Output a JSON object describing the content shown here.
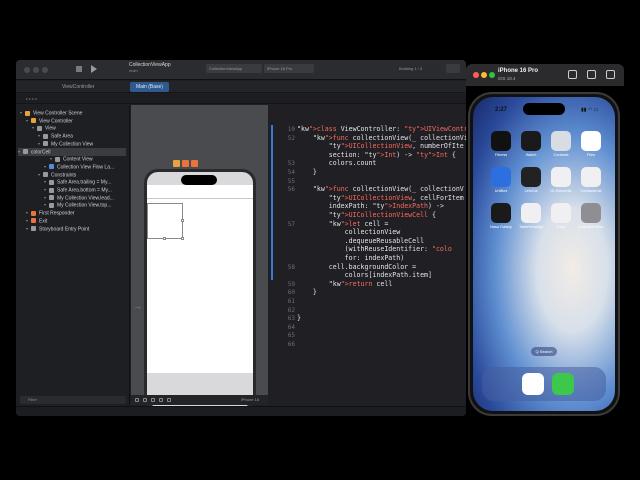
{
  "xcode": {
    "project_title": "CollectionViewApp",
    "project_subtitle": "main",
    "scheme": "CollectionViewApp",
    "device_target": "iPhone 16 Pro",
    "build_status": "Building 1 / 3",
    "tabs": [
      "ViewController",
      "Main (Base)"
    ],
    "filter_placeholder": "Filter",
    "canvas_device_label": "iPhone 16",
    "outline": [
      {
        "label": "View Controller Scene",
        "level": 0,
        "icon_color": "#e8a33d"
      },
      {
        "label": "View Controller",
        "level": 1,
        "icon_color": "#e8a33d"
      },
      {
        "label": "View",
        "level": 2,
        "icon_color": "#9a9a9e"
      },
      {
        "label": "Safe Area",
        "level": 3,
        "icon_color": "#9a9a9e"
      },
      {
        "label": "My Collection View",
        "level": 3,
        "icon_color": "#9a9a9e"
      },
      {
        "label": "colorCell",
        "level": 4,
        "icon_color": "#9a9a9e",
        "selected": true
      },
      {
        "label": "Content View",
        "level": 5,
        "icon_color": "#9a9a9e"
      },
      {
        "label": "Collection View Flow La...",
        "level": 4,
        "icon_color": "#5a8ad8"
      },
      {
        "label": "Constraints",
        "level": 3,
        "icon_color": "#9a9a9e"
      },
      {
        "label": "Safe Area.trailing = My...",
        "level": 4,
        "icon_color": "#9a9a9e"
      },
      {
        "label": "Safe Area.bottom = My...",
        "level": 4,
        "icon_color": "#9a9a9e"
      },
      {
        "label": "My Collection View.lead...",
        "level": 4,
        "icon_color": "#9a9a9e"
      },
      {
        "label": "My Collection View.top...",
        "level": 4,
        "icon_color": "#9a9a9e"
      },
      {
        "label": "First Responder",
        "level": 1,
        "icon_color": "#e8743d"
      },
      {
        "label": "Exit",
        "level": 1,
        "icon_color": "#e8743d"
      },
      {
        "label": "Storyboard Entry Point",
        "level": 1,
        "icon_color": "#9a9a9e"
      }
    ],
    "code_lines": [
      {
        "n": "10",
        "text": "class ViewController: UIViewController"
      },
      {
        "n": "52",
        "text": "    func collectionView(_ collectionVi"
      },
      {
        "n": "",
        "text": "        UICollectionView, numberOfIte"
      },
      {
        "n": "",
        "text": "        section: Int) -> Int {"
      },
      {
        "n": "53",
        "text": "        colors.count"
      },
      {
        "n": "54",
        "text": "    }"
      },
      {
        "n": "55",
        "text": ""
      },
      {
        "n": "56",
        "text": "    func collectionView(_ collectionV"
      },
      {
        "n": "",
        "text": "        UICollectionView, cellForItem"
      },
      {
        "n": "",
        "text": "        indexPath: IndexPath) ->"
      },
      {
        "n": "",
        "text": "        UICollectionViewCell {"
      },
      {
        "n": "57",
        "text": "        let cell ="
      },
      {
        "n": "",
        "text": "            collectionView"
      },
      {
        "n": "",
        "text": "            .dequeueReusableCell"
      },
      {
        "n": "",
        "text": "            (withReuseIdentifier: \"colo"
      },
      {
        "n": "",
        "text": "            for: indexPath)"
      },
      {
        "n": "58",
        "text": "        cell.backgroundColor ="
      },
      {
        "n": "",
        "text": "            colors[indexPath.item]"
      },
      {
        "n": "59",
        "text": "        return cell"
      },
      {
        "n": "60",
        "text": "    }"
      },
      {
        "n": "61",
        "text": ""
      },
      {
        "n": "62",
        "text": ""
      },
      {
        "n": "63",
        "text": "}"
      },
      {
        "n": "64",
        "text": ""
      },
      {
        "n": "65",
        "text": ""
      },
      {
        "n": "66",
        "text": ""
      }
    ]
  },
  "simulator": {
    "device_name": "iPhone 16 Pro",
    "os_version": "iOS 18.4",
    "status_time": "2:27",
    "apps": [
      {
        "label": "Fitness",
        "color": "#111111",
        "icon": "fitness-icon"
      },
      {
        "label": "Watch",
        "color": "#1a1a1a",
        "icon": "watch-icon"
      },
      {
        "label": "Contacts",
        "color": "#d9dde3",
        "icon": "contacts-icon"
      },
      {
        "label": "Files",
        "color": "#ffffff",
        "icon": "files-icon"
      },
      {
        "label": "Uniflies",
        "color": "#2d6fe0",
        "icon": "uniflies-icon"
      },
      {
        "label": "LetsCal",
        "color": "#222222",
        "icon": "letscal-icon"
      },
      {
        "label": "UI-Elements",
        "color": "#f0f0f2",
        "icon": "ui-elements-icon"
      },
      {
        "label": "ContactsList",
        "color": "#f0f0f2",
        "icon": "contactslist-icon"
      },
      {
        "label": "Nasa Galaxy",
        "color": "#1a1a1a",
        "icon": "nasa-galaxy-icon"
      },
      {
        "label": "TableViewApp",
        "color": "#f0f0f2",
        "icon": "tableviewapp-icon"
      },
      {
        "label": "Easy",
        "color": "#f0f0f2",
        "icon": "easy-icon"
      },
      {
        "label": "CollectionView...",
        "color": "#8e8e93",
        "icon": "collectionview-app-icon"
      }
    ],
    "search_label": "Q Search",
    "dock": [
      {
        "icon": "safari-icon",
        "color": "#ffffff"
      },
      {
        "icon": "messages-icon",
        "color": "#3cc84a"
      }
    ]
  }
}
